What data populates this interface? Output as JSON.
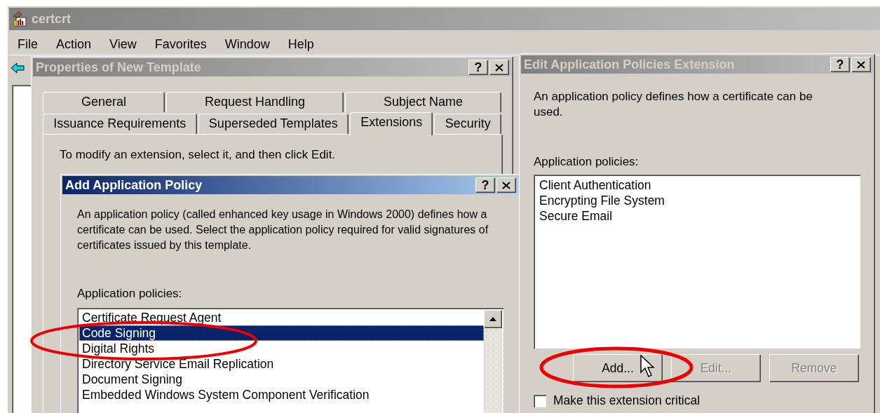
{
  "main_window": {
    "title": "certcrt",
    "active": false,
    "menu": [
      "File",
      "Action",
      "View",
      "Favorites",
      "Window",
      "Help"
    ]
  },
  "properties_dialog": {
    "title": "Properties of New Template",
    "active": false,
    "help_glyph": "?",
    "tab_rows": [
      [
        {
          "label": "General",
          "selected": false
        },
        {
          "label": "Request Handling",
          "selected": false
        },
        {
          "label": "Subject Name",
          "selected": false
        }
      ],
      [
        {
          "label": "Issuance Requirements",
          "selected": false
        },
        {
          "label": "Superseded Templates",
          "selected": false
        },
        {
          "label": "Extensions",
          "selected": true
        },
        {
          "label": "Security",
          "selected": false
        }
      ]
    ],
    "instruction": "To modify an extension, select it, and then click Edit."
  },
  "add_policy_dialog": {
    "title": "Add Application Policy",
    "active": true,
    "help_glyph": "?",
    "description": "An application policy (called enhanced key usage in Windows 2000) defines how a certificate can be used. Select the application policy required for valid signatures of certificates issued by this template.",
    "list_label": "Application policies:",
    "policies": [
      {
        "label": "Certificate Request Agent",
        "selected": false
      },
      {
        "label": "Code Signing",
        "selected": true
      },
      {
        "label": "Digital Rights",
        "selected": false
      },
      {
        "label": "Directory Service Email Replication",
        "selected": false
      },
      {
        "label": "Document Signing",
        "selected": false
      },
      {
        "label": "Embedded Windows System Component Verification",
        "selected": false
      }
    ]
  },
  "edit_extension_dialog": {
    "title": "Edit Application Policies Extension",
    "active": false,
    "help_glyph": "?",
    "description": "An application policy defines how a certificate can be used.",
    "list_label": "Application policies:",
    "policies": [
      "Client Authentication",
      "Encrypting File System",
      "Secure Email"
    ],
    "buttons": [
      {
        "label": "Add...",
        "disabled": false
      },
      {
        "label": "Edit...",
        "disabled": true
      },
      {
        "label": "Remove",
        "disabled": true
      }
    ],
    "critical_checkbox": {
      "label": "Make this extension critical",
      "checked": false
    }
  }
}
